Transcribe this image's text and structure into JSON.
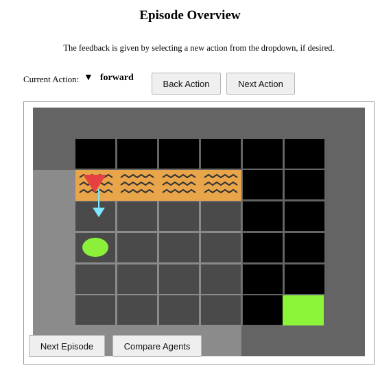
{
  "header": {
    "title": "Episode Overview",
    "subtitle": "The feedback is given by selecting a new action from the dropdown, if desired."
  },
  "controls": {
    "current_action_label": "Current Action:",
    "current_action_value": "forward",
    "dropdown_icon": "triangle-down-icon",
    "back_action": "Back Action",
    "next_action": "Next Action",
    "next_episode": "Next Episode",
    "compare_agents": "Compare Agents"
  },
  "environment": {
    "grid_columns": 6,
    "grid_rows": 6,
    "agent_direction": "down",
    "objects": [
      "agent",
      "lava",
      "ball",
      "goal",
      "wall"
    ],
    "colors": {
      "background": "#646464",
      "floor": "#4a4a4a",
      "unexplored": "#000000",
      "lava": "#e8a54a",
      "agent": "#e54141",
      "arrow": "#7fe6ff",
      "ball": "#8cef3a",
      "goal": "#8cf53a"
    }
  }
}
